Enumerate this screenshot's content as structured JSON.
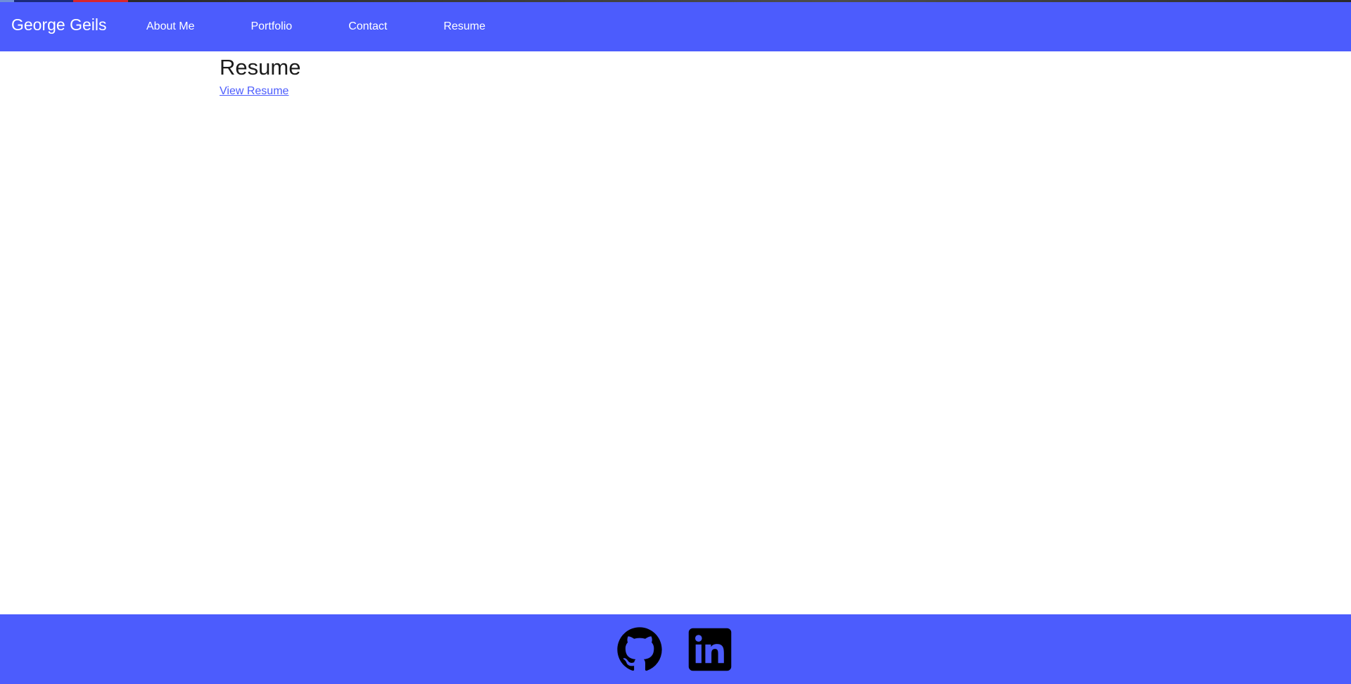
{
  "navbar": {
    "brand": "George Geils",
    "links": [
      {
        "label": "About Me"
      },
      {
        "label": "Portfolio"
      },
      {
        "label": "Contact"
      },
      {
        "label": "Resume"
      }
    ]
  },
  "main": {
    "title": "Resume",
    "view_resume_label": "View Resume"
  },
  "footer": {
    "icons": [
      "github-icon",
      "linkedin-icon"
    ]
  },
  "colors": {
    "accent": "#4c5cfd",
    "icon": "#000000",
    "text": "#1b1b1b"
  }
}
